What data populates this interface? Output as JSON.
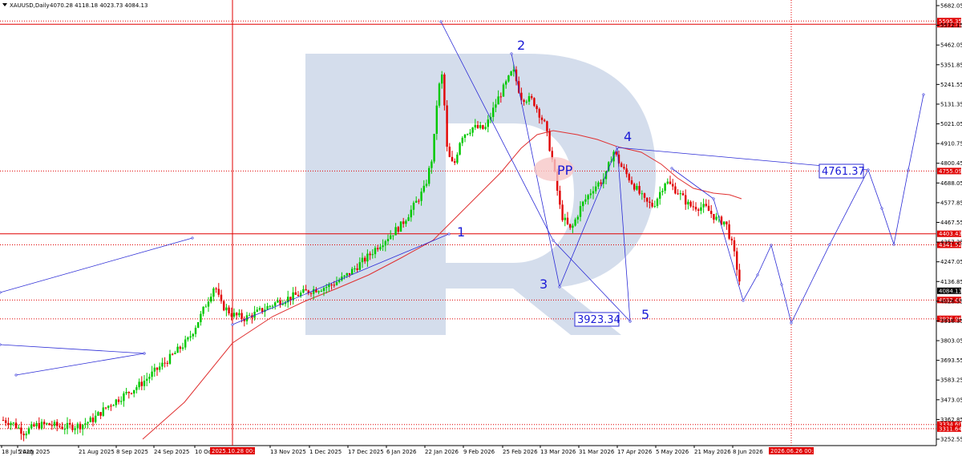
{
  "header": {
    "menu_icon": "triangle-down-icon",
    "symbol": "XAUUSD,Daily",
    "ohlc": "4070.28 4118.18 4023.73 4084.13"
  },
  "chart_data": {
    "type": "candlestick",
    "y_axis": {
      "ticks": [
        "5682.05",
        "5572.15",
        "5462.05",
        "5351.85",
        "5241.55",
        "5131.35",
        "5021.05",
        "4910.75",
        "4800.45",
        "4688.05",
        "4577.85",
        "4467.55",
        "4357.25",
        "4247.05",
        "4136.85",
        "4026.55",
        "3916.35",
        "3803.05",
        "3693.55",
        "3583.25",
        "3473.05",
        "3362.85",
        "3252.55"
      ]
    },
    "x_axis": {
      "ticks": [
        "18 Jul 2025",
        "5 Aug 2025",
        "21 Aug 2025",
        "8 Sep 2025",
        "24 Sep 2025",
        "10 Oct 2025",
        "13 Nov 2025",
        "1 Dec 2025",
        "17 Dec 2025",
        "6 Jan 2026",
        "22 Jan 2026",
        "9 Feb 2026",
        "25 Feb 2026",
        "13 Mar 2026",
        "31 Mar 2026",
        "17 Apr 2026",
        "5 May 2026",
        "21 May 2026",
        "8 Jun 2026"
      ],
      "cursor_label": "2025.10.28 00:00",
      "forecast_label": "2026.06.26 00:00"
    },
    "price_levels": [
      {
        "price": "5577.71",
        "style": "solid"
      },
      {
        "price": "5595.35",
        "style": "dotted"
      },
      {
        "price": "4755.09",
        "style": "dotted"
      },
      {
        "price": "4403.43",
        "style": "solid"
      },
      {
        "price": "4341.52",
        "style": "dotted"
      },
      {
        "price": "4032.48",
        "style": "dotted"
      },
      {
        "price": "3926.96",
        "style": "dotted"
      },
      {
        "price": "3334.60",
        "style": "dotted"
      },
      {
        "price": "3311.64",
        "style": "dotted"
      }
    ],
    "current_price": "4084.13",
    "wave_labels": [
      "1",
      "2",
      "3",
      "4",
      "5",
      "PP"
    ],
    "box_labels": [
      "3923.34",
      "4761.37"
    ],
    "colors": {
      "bull": "#00c800",
      "bear": "#e00000",
      "ma": "#e03030",
      "level": "#e00000",
      "wave": "#2b2bd6",
      "logo": "#c6d2e6"
    }
  }
}
